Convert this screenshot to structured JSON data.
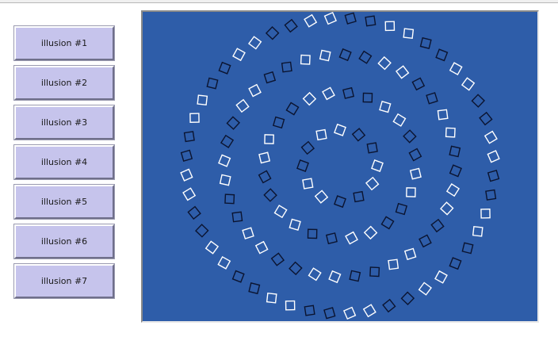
{
  "buttons": [
    {
      "label": "illusion #1"
    },
    {
      "label": "illusion #2"
    },
    {
      "label": "illusion #3"
    },
    {
      "label": "illusion #4"
    },
    {
      "label": "illusion #5"
    },
    {
      "label": "illusion #6"
    },
    {
      "label": "illusion #7"
    }
  ],
  "canvas": {
    "background_color": "#2e5da9",
    "square_colors": [
      "#ffffff",
      "#0b1430"
    ],
    "rings": [
      {
        "squares": 12
      },
      {
        "squares": 24
      },
      {
        "squares": 36
      },
      {
        "squares": 48
      }
    ]
  }
}
